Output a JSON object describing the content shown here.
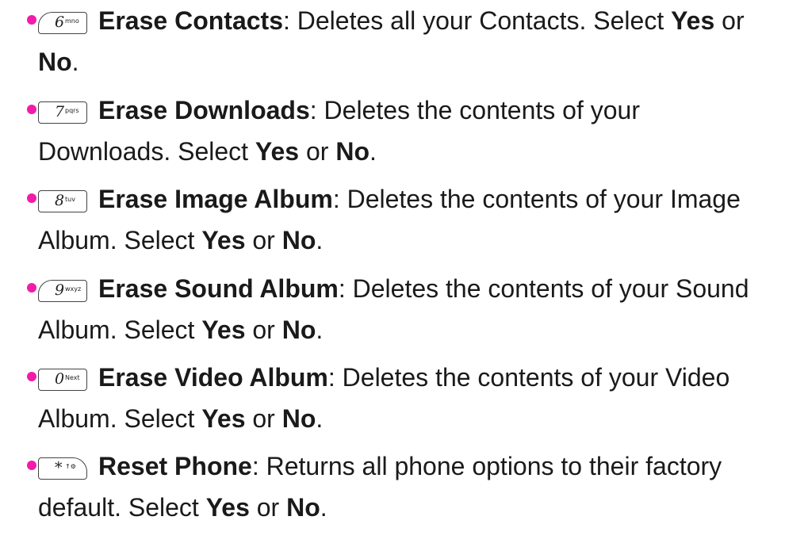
{
  "items": [
    {
      "key": {
        "main": "6",
        "sub": "mno"
      },
      "title": "Erase Contacts",
      "line1_desc": ": Deletes all your Contacts. Select ",
      "line1_yes": "Yes",
      "line1_or": " or",
      "line2_no": "No",
      "line2_end": "."
    },
    {
      "key": {
        "main": "7",
        "sub": "pqrs"
      },
      "title": "Erase Downloads",
      "line1_desc": ": Deletes the contents of your",
      "line2_text": "Downloads. Select ",
      "line2_yes": "Yes",
      "line2_or": " or ",
      "line2_no": "No",
      "line2_end": "."
    },
    {
      "key": {
        "main": "8",
        "sub": "tuv"
      },
      "title": "Erase Image Album",
      "line1_desc": ": Deletes the contents of your Image",
      "line2_text": "Album. Select ",
      "line2_yes": "Yes",
      "line2_or": " or ",
      "line2_no": "No",
      "line2_end": "."
    },
    {
      "key": {
        "main": "9",
        "sub": "wxyz"
      },
      "title": "Erase Sound Album",
      "line1_desc": ": Deletes the contents of your Sound",
      "line2_text": "Album. Select ",
      "line2_yes": "Yes",
      "line2_or": " or ",
      "line2_no": "No",
      "line2_end": "."
    },
    {
      "key": {
        "main": "0",
        "sub": "Next"
      },
      "title": "Erase Video Album",
      "line1_desc": ": Deletes the contents of your Video",
      "line2_text": "Album. Select ",
      "line2_yes": "Yes",
      "line2_or": " or ",
      "line2_no": "No",
      "line2_end": "."
    },
    {
      "key": {
        "main": "*",
        "sub": "↑⚙"
      },
      "title": "Reset Phone",
      "line1_desc": ": Returns all phone options to their factory",
      "line2_text": "default. Select ",
      "line2_yes": "Yes",
      "line2_or": " or ",
      "line2_no": "No",
      "line2_end": "."
    }
  ],
  "colors": {
    "bullet": "#f21ca9",
    "text": "#1a1a1a"
  }
}
